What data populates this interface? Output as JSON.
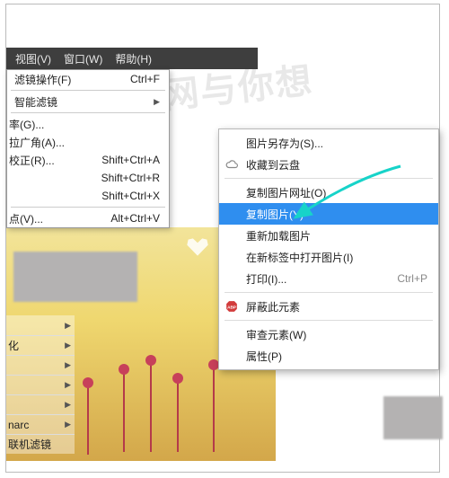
{
  "watermark": "天极网与你想",
  "menubar": {
    "view": "视图(V)",
    "window": "窗口(W)",
    "help": "帮助(H)"
  },
  "left_menu": {
    "filter_op": {
      "label": "滤镜操作(F)",
      "shortcut": "Ctrl+F"
    },
    "smart_filter": "智能滤镜",
    "group1": [
      {
        "label": "率(G)..."
      },
      {
        "label": "拉广角(A)..."
      },
      {
        "label": "校正(R)...",
        "shortcut": "Shift+Ctrl+A"
      },
      {
        "label": "",
        "shortcut": "Shift+Ctrl+R"
      },
      {
        "label": "",
        "shortcut": "Shift+Ctrl+X"
      }
    ],
    "vanish": {
      "label": "点(V)...",
      "shortcut": "Alt+Ctrl+V"
    }
  },
  "left_labels": [
    "",
    "化",
    "",
    "",
    "",
    "narc",
    "联机滤镜"
  ],
  "context_menu": {
    "save_as": "图片另存为(S)...",
    "save_cloud": "收藏到云盘",
    "copy_url": "复制图片网址(O)",
    "copy_img": "复制图片(Y)",
    "reload": "重新加载图片",
    "open_tab": "在新标签中打开图片(I)",
    "print": {
      "label": "打印(I)...",
      "shortcut": "Ctrl+P"
    },
    "block": "屏蔽此元素",
    "inspect": "审查元素(W)",
    "props": "属性(P)"
  }
}
